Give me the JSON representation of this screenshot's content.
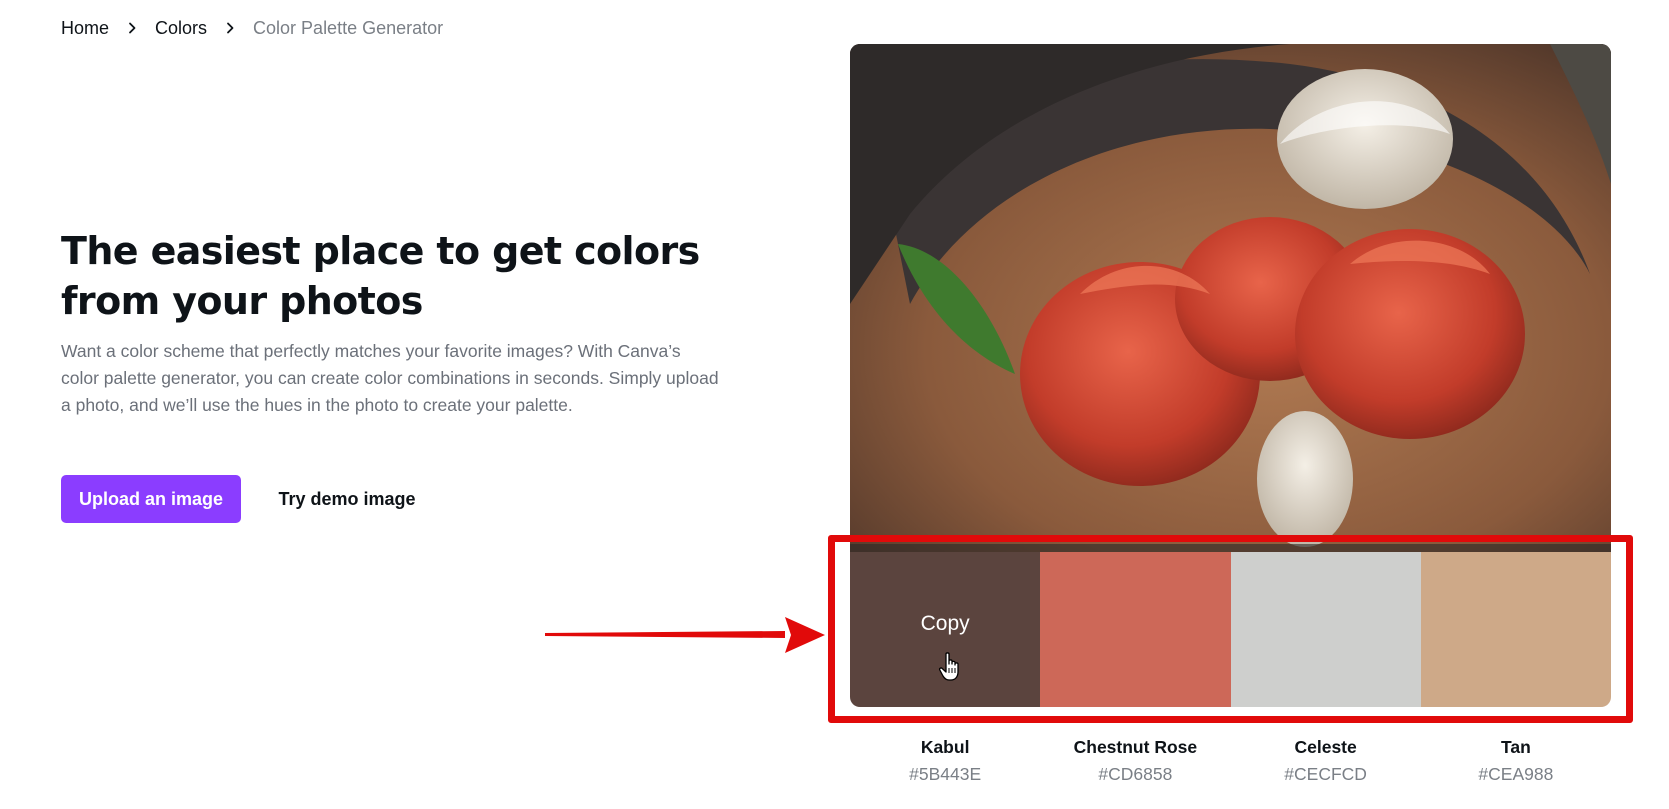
{
  "breadcrumb": {
    "home": "Home",
    "colors": "Colors",
    "current": "Color Palette Generator"
  },
  "hero": {
    "title_line1": "The easiest place to get colors",
    "title_line2": "from your photos",
    "description": "Want a color scheme that perfectly matches your favorite images? With Canva’s color palette generator, you can create color combinations in seconds. Simply upload a photo, and we’ll use the hues in the photo to create your palette."
  },
  "buttons": {
    "upload": "Upload an image",
    "demo": "Try demo image"
  },
  "palette": {
    "copy_label": "Copy",
    "swatches": [
      {
        "name": "Kabul",
        "hex": "#5B443E"
      },
      {
        "name": "Chestnut Rose",
        "hex": "#CD6858"
      },
      {
        "name": "Celeste",
        "hex": "#CECFCD"
      },
      {
        "name": "Tan",
        "hex": "#CEA988"
      }
    ]
  },
  "colors": {
    "accent": "#8B3DFF",
    "annotation_red": "#E10A0A"
  }
}
